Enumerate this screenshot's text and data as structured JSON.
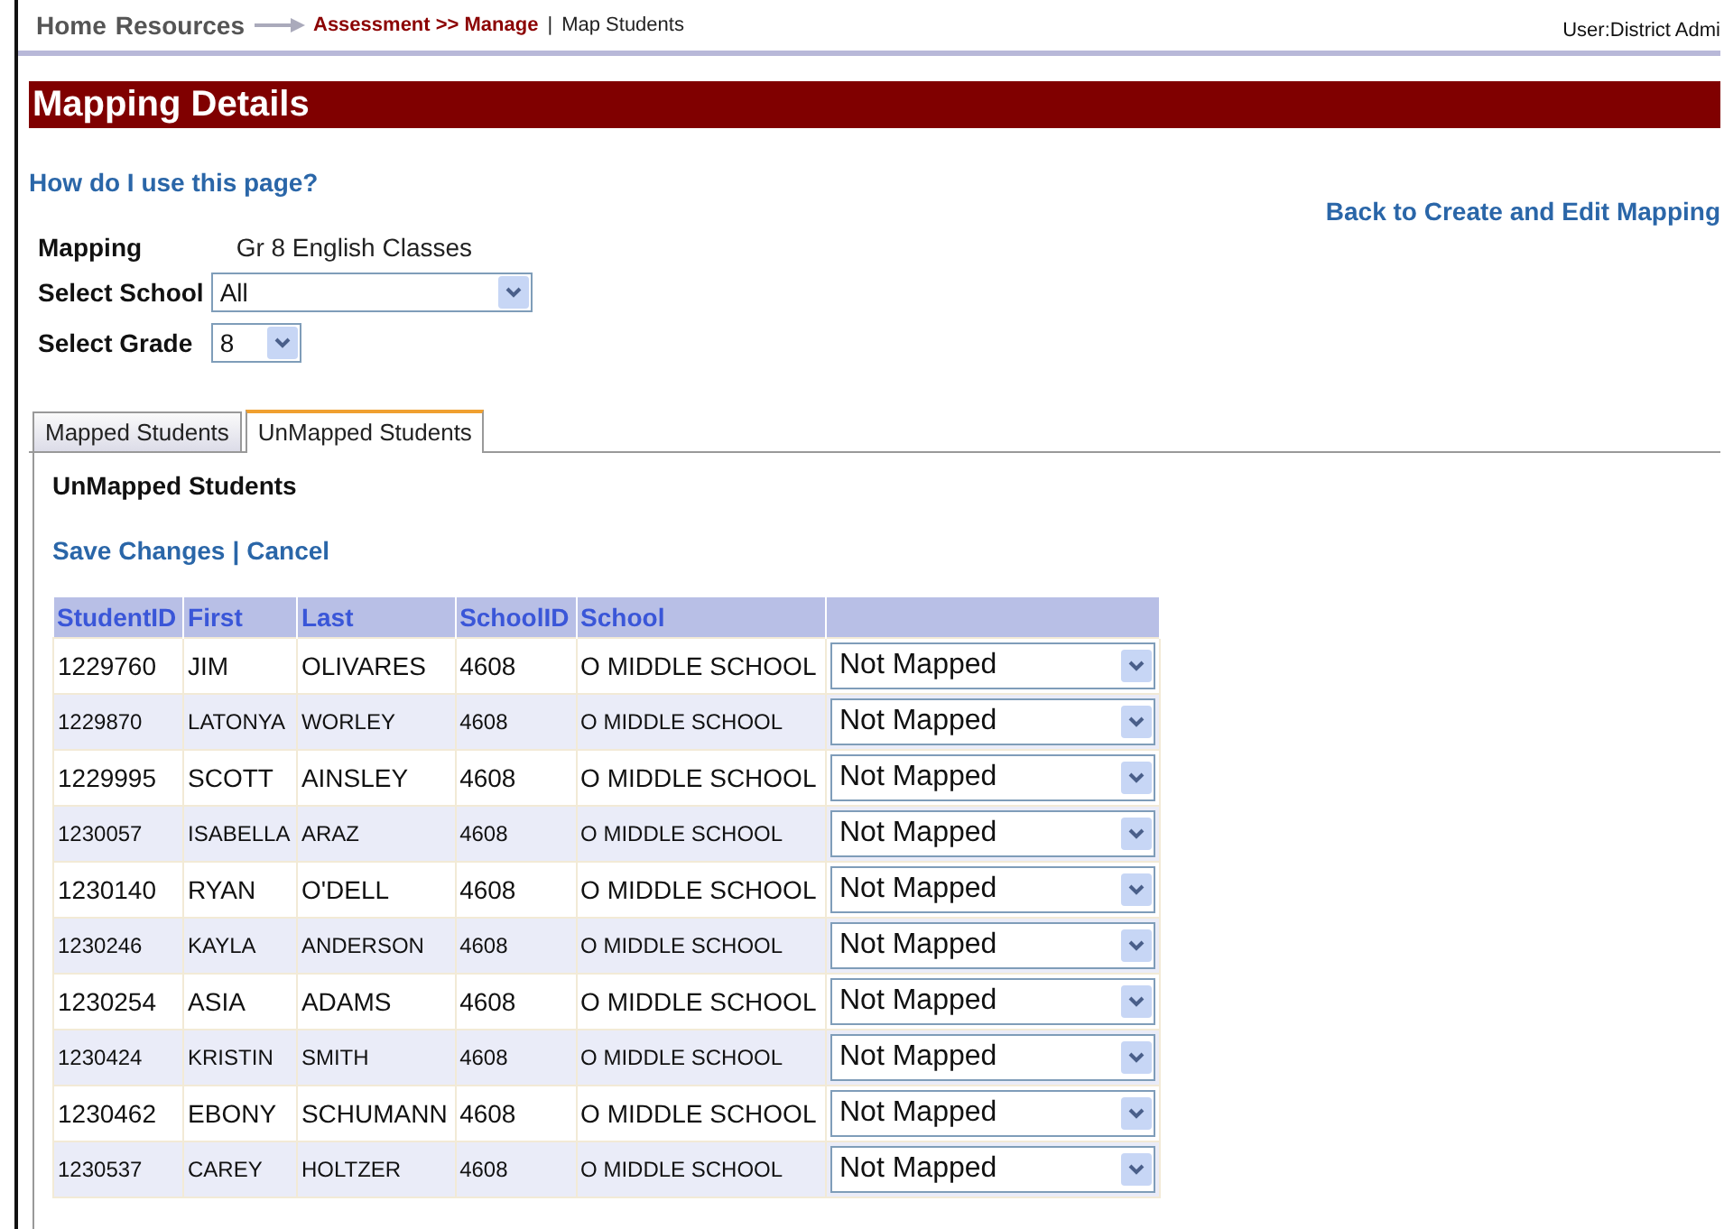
{
  "breadcrumb": {
    "home": "Home",
    "resources": "Resources",
    "section": "Assessment >> Manage",
    "separator": "|",
    "current": "Map Students"
  },
  "user": "User:District Admi",
  "title": "Mapping Details",
  "help_link": "How do I use this page?",
  "back_link": "Back to Create and Edit Mapping",
  "mapping": {
    "label": "Mapping",
    "value": "Gr 8 English Classes"
  },
  "school_select": {
    "label": "Select School",
    "value": "All"
  },
  "grade_select": {
    "label": "Select Grade",
    "value": "8"
  },
  "tabs": [
    {
      "label": "Mapped Students",
      "selected": false
    },
    {
      "label": "UnMapped Students",
      "selected": true
    }
  ],
  "panel_title": "UnMapped Students",
  "actions": {
    "save": "Save Changes",
    "separator": "|",
    "cancel": "Cancel"
  },
  "table": {
    "columns": [
      "StudentID",
      "First",
      "Last",
      "SchoolID",
      "School"
    ],
    "rows": [
      {
        "id": "1229760",
        "first": "JIM",
        "last": "OLIVARES",
        "school_id": "4608",
        "school": "O MIDDLE SCHOOL",
        "mapping": "Not Mapped"
      },
      {
        "id": "1229870",
        "first": "LATONYA",
        "last": "WORLEY",
        "school_id": "4608",
        "school": "O MIDDLE SCHOOL",
        "mapping": "Not Mapped"
      },
      {
        "id": "1229995",
        "first": "SCOTT",
        "last": "AINSLEY",
        "school_id": "4608",
        "school": "O MIDDLE SCHOOL",
        "mapping": "Not Mapped"
      },
      {
        "id": "1230057",
        "first": "ISABELLA",
        "last": "ARAZ",
        "school_id": "4608",
        "school": "O MIDDLE SCHOOL",
        "mapping": "Not Mapped"
      },
      {
        "id": "1230140",
        "first": "RYAN",
        "last": "O'DELL",
        "school_id": "4608",
        "school": "O MIDDLE SCHOOL",
        "mapping": "Not Mapped"
      },
      {
        "id": "1230246",
        "first": "KAYLA",
        "last": "ANDERSON",
        "school_id": "4608",
        "school": "O MIDDLE SCHOOL",
        "mapping": "Not Mapped"
      },
      {
        "id": "1230254",
        "first": "ASIA",
        "last": "ADAMS",
        "school_id": "4608",
        "school": "O MIDDLE SCHOOL",
        "mapping": "Not Mapped"
      },
      {
        "id": "1230424",
        "first": "KRISTIN",
        "last": "SMITH",
        "school_id": "4608",
        "school": "O MIDDLE SCHOOL",
        "mapping": "Not Mapped"
      },
      {
        "id": "1230462",
        "first": "EBONY",
        "last": "SCHUMANN",
        "school_id": "4608",
        "school": "O MIDDLE SCHOOL",
        "mapping": "Not Mapped"
      },
      {
        "id": "1230537",
        "first": "CAREY",
        "last": "HOLTZER",
        "school_id": "4608",
        "school": "O MIDDLE SCHOOL",
        "mapping": "Not Mapped"
      }
    ]
  }
}
